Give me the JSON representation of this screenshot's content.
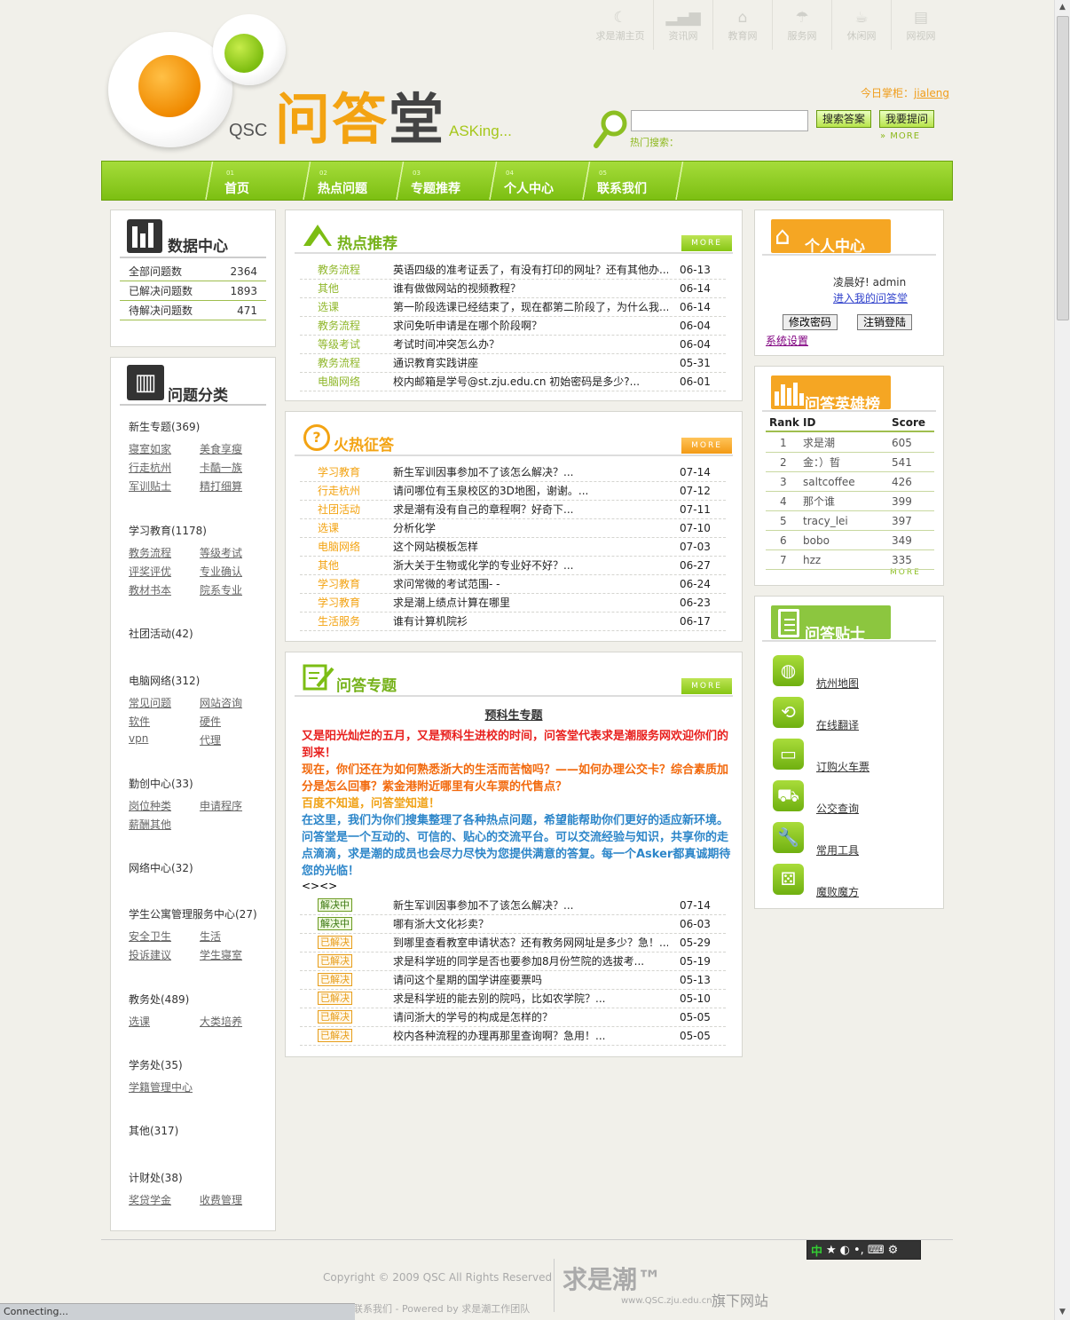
{
  "site_links": [
    {
      "label": "求是潮主页",
      "icon": "wave-icon"
    },
    {
      "label": "资讯网",
      "icon": "signal-icon"
    },
    {
      "label": "教育网",
      "icon": "graduation-cap-icon"
    },
    {
      "label": "服务网",
      "icon": "umbrella-icon"
    },
    {
      "label": "休闲网",
      "icon": "coffee-icon"
    },
    {
      "label": "网视网",
      "icon": "film-icon"
    }
  ],
  "logo": {
    "qsc": "QSC",
    "cn_1": "问答",
    "cn_2": "堂",
    "en": "ASKing..."
  },
  "header": {
    "today_label": "今日掌柜：",
    "today_user": "jialeng",
    "search_button": "搜索答案",
    "ask_button": "我要提问",
    "hot_label": "热门搜索：",
    "more": "» MORE",
    "search_value": ""
  },
  "nav": [
    {
      "num": "01",
      "label": "首页"
    },
    {
      "num": "02",
      "label": "热点问题"
    },
    {
      "num": "03",
      "label": "专题推荐"
    },
    {
      "num": "04",
      "label": "个人中心"
    },
    {
      "num": "05",
      "label": "联系我们"
    }
  ],
  "data_center": {
    "title": "数据中心",
    "rows": [
      {
        "label": "全部问题数",
        "value": "2364"
      },
      {
        "label": "已解决问题数",
        "value": "1893"
      },
      {
        "label": "待解决问题数",
        "value": "471"
      }
    ]
  },
  "categories": {
    "title": "问题分类",
    "groups": [
      {
        "name": "新生专题(369)",
        "links": [
          "寝室如家",
          "美食享瘦",
          "行走杭州",
          "卡酷一族",
          "军训贴士",
          "精打细算"
        ]
      },
      {
        "name": "学习教育(1178)",
        "links": [
          "教务流程",
          "等级考试",
          "评奖评优",
          "专业确认",
          "教材书本",
          "院系专业"
        ]
      },
      {
        "name": "社团活动(42)",
        "links": []
      },
      {
        "name": "电脑网络(312)",
        "links": [
          "常见问题",
          "网站咨询",
          "软件",
          "硬件",
          "vpn",
          "代理"
        ]
      },
      {
        "name": "勤创中心(33)",
        "links": [
          "岗位种类",
          "申请程序",
          "薪酬其他"
        ]
      },
      {
        "name": "网络中心(32)",
        "links": []
      },
      {
        "name": "学生公寓管理服务中心(27)",
        "links": [
          "安全卫生",
          "生活",
          "投诉建议",
          "学生寝室"
        ]
      },
      {
        "name": "教务处(489)",
        "links": [
          "选课",
          "大类培养"
        ]
      },
      {
        "name": "学务处(35)",
        "links": [
          "学籍管理中心"
        ]
      },
      {
        "name": "其他(317)",
        "links": []
      },
      {
        "name": "计财处(38)",
        "links": [
          "奖贷学金",
          "收费管理"
        ]
      }
    ]
  },
  "hot": {
    "title": "热点推荐",
    "more": "MORE",
    "rows": [
      {
        "cat": "教务流程",
        "title": "英语四级的准考证丢了，有没有打印的网址？还有其他办...",
        "date": "06-13"
      },
      {
        "cat": "其他",
        "title": "谁有做做网站的视频教程？",
        "date": "06-14"
      },
      {
        "cat": "选课",
        "title": "第一阶段选课已经结束了，现在都第二阶段了，为什么我...",
        "date": "06-14"
      },
      {
        "cat": "教务流程",
        "title": "求问免听申请是在哪个阶段啊？",
        "date": "06-04"
      },
      {
        "cat": "等级考试",
        "title": "考试时间冲突怎么办？",
        "date": "06-04"
      },
      {
        "cat": "教务流程",
        "title": "通识教育实践讲座",
        "date": "05-31"
      },
      {
        "cat": "电脑网络",
        "title": "校内邮箱是学号@st.zju.edu.cn 初始密码是多少?...",
        "date": "06-01"
      }
    ]
  },
  "fire": {
    "title": "火热征答",
    "more": "MORE",
    "rows": [
      {
        "cat": "学习教育",
        "title": "新生军训因事参加不了该怎么解决？...",
        "date": "07-14"
      },
      {
        "cat": "行走杭州",
        "title": "请问哪位有玉泉校区的3D地图，谢谢。...",
        "date": "07-12"
      },
      {
        "cat": "社团活动",
        "title": "求是潮有没有自己的章程啊？好奇下...",
        "date": "07-11"
      },
      {
        "cat": "选课",
        "title": "分析化学",
        "date": "07-10"
      },
      {
        "cat": "电脑网络",
        "title": "这个网站模板怎样",
        "date": "07-03"
      },
      {
        "cat": "其他",
        "title": "浙大关于生物或化学的专业好不好？...",
        "date": "06-27"
      },
      {
        "cat": "学习教育",
        "title": "求问常微的考试范围- -",
        "date": "06-24"
      },
      {
        "cat": "学习教育",
        "title": "求是潮上绩点计算在哪里",
        "date": "06-23"
      },
      {
        "cat": "生活服务",
        "title": "谁有计算机院衫",
        "date": "06-17"
      }
    ]
  },
  "special": {
    "title": "问答专题",
    "more": "MORE",
    "subject": "预科生专题",
    "p1": "又是阳光灿烂的五月，又是预科生进校的时间，问答堂代表求是潮服务网欢迎你们的到来！",
    "p2": "现在，你们还在为如何熟悉浙大的生活而苦恼吗？——如何办理公交卡？综合素质加分是怎么回事？紫金港附近哪里有火车票的代售点？",
    "p3": "百度不知道，问答堂知道！",
    "p4": "在这里，我们为你们搜集整理了各种热点问题，希望能帮助你们更好的适应新环境。问答堂是一个互动的、可信的、贴心的交流平台。可以交流经验与知识，共享你的走点滴滴，求是潮的成员也会尽力尽快为您提供满意的答复。每一个Asker都真诚期待您的光临！",
    "nav": "<><>",
    "rows": [
      {
        "status": "解决中",
        "title": "新生军训因事参加不了该怎么解决？...",
        "date": "07-14"
      },
      {
        "status": "解决中",
        "title": "哪有浙大文化衫卖？",
        "date": "06-03"
      },
      {
        "status": "已解决",
        "title": "到哪里查看教室申请状态？还有教务网网址是多少？急！...",
        "date": "05-29"
      },
      {
        "status": "已解决",
        "title": "求是科学班的同学是否也要参加8月份竺院的选拔考...",
        "date": "05-19"
      },
      {
        "status": "已解决",
        "title": "请问这个星期的国学讲座要票吗",
        "date": "05-13"
      },
      {
        "status": "已解决",
        "title": "求是科学班的能去别的院吗，比如农学院？...",
        "date": "05-10"
      },
      {
        "status": "已解决",
        "title": "请问浙大的学号的构成是怎样的？",
        "date": "05-05"
      },
      {
        "status": "已解决",
        "title": "校内各种流程的办理再那里查询啊？急用！...",
        "date": "05-05"
      }
    ]
  },
  "personal": {
    "title": "个人中心",
    "greeting": "凌晨好! admin",
    "enter": "进入我的问答堂",
    "change_pwd": "修改密码",
    "logout": "注销登陆",
    "settings": "系统设置"
  },
  "heroes": {
    "title": "问答英雄榜",
    "headers": [
      "Rank",
      "ID",
      "Score"
    ],
    "more": "MORE",
    "rows": [
      {
        "rank": "1",
        "id": "求是潮",
        "score": "605"
      },
      {
        "rank": "2",
        "id": "金：）晢",
        "score": "541"
      },
      {
        "rank": "3",
        "id": "saltcoffee",
        "score": "426"
      },
      {
        "rank": "4",
        "id": "那个谁",
        "score": "399"
      },
      {
        "rank": "5",
        "id": "tracy_lei",
        "score": "397"
      },
      {
        "rank": "6",
        "id": "bobo",
        "score": "349"
      },
      {
        "rank": "7",
        "id": "hzz",
        "score": "335"
      }
    ]
  },
  "tips": {
    "title": "问答贴士",
    "items": [
      {
        "label": "杭州地图",
        "icon": "globe-icon"
      },
      {
        "label": "在线翻译",
        "icon": "translate-icon"
      },
      {
        "label": "订购火车票",
        "icon": "ticket-icon"
      },
      {
        "label": "公交查询",
        "icon": "car-icon"
      },
      {
        "label": "常用工具",
        "icon": "wrench-icon"
      },
      {
        "label": "魔败魔方",
        "icon": "dice-icon"
      }
    ]
  },
  "footer": {
    "copyright": "Copyright © 2009 QSC All Rights Reserved",
    "powered": "联系我们 - Powered by 求是潮工作团队",
    "brand": "求是潮™",
    "domain": "www.QSC.zju.edu.cn",
    "sub": "旗下网站"
  },
  "ime": {
    "lang": "中"
  },
  "status": "Connecting..."
}
